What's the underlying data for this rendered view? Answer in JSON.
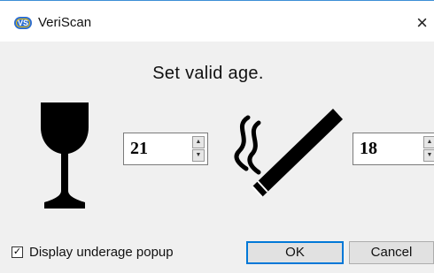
{
  "window": {
    "title": "VeriScan",
    "app_icon_text": "VS",
    "close_glyph": "×",
    "close_icon": "close-icon"
  },
  "dialog": {
    "prompt": "Set valid age."
  },
  "alcohol": {
    "icon": "wine-glass-icon",
    "age_value": "21"
  },
  "tobacco": {
    "icon": "cigarette-icon",
    "age_value": "18"
  },
  "spinner": {
    "up_glyph": "▲",
    "down_glyph": "▼"
  },
  "options": {
    "underage_popup_label": "Display underage popup",
    "underage_popup_checked": true,
    "check_glyph": "✓"
  },
  "buttons": {
    "ok_label": "OK",
    "cancel_label": "Cancel"
  },
  "colors": {
    "accent": "#0078d7",
    "app_icon": "#2f6fd0",
    "dialog_bg": "#f0f0f0"
  }
}
